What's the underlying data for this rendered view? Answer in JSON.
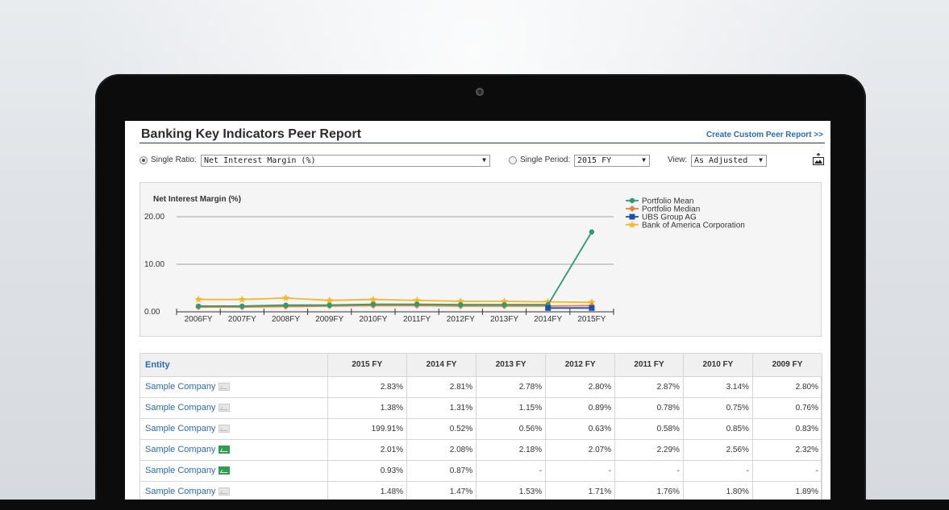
{
  "header": {
    "title": "Banking Key Indicators Peer Report",
    "custom_link": "Create Custom Peer Report >>"
  },
  "controls": {
    "single_ratio_label": "Single Ratio:",
    "ratio_value": "Net Interest Margin (%)",
    "single_period_label": "Single Period:",
    "period_value": "2015 FY",
    "view_label": "View:",
    "view_value": "As Adjusted"
  },
  "chart_data": {
    "type": "line",
    "title": "Net Interest Margin (%)",
    "x": [
      "2006FY",
      "2007FY",
      "2008FY",
      "2009FY",
      "2010FY",
      "2011FY",
      "2012FY",
      "2013FY",
      "2014FY",
      "2015FY"
    ],
    "ylim": [
      0,
      20
    ],
    "yticks": [
      "0.00",
      "10.00",
      "20.00"
    ],
    "legend_position": "top-right",
    "series": [
      {
        "name": "Portfolio Mean",
        "color": "#2e9a72",
        "marker": "circle",
        "values": [
          1.2,
          1.2,
          1.4,
          1.4,
          1.6,
          1.6,
          1.5,
          1.5,
          1.5,
          16.8
        ]
      },
      {
        "name": "Portfolio Median",
        "color": "#e8813a",
        "marker": "diamond",
        "values": [
          1.0,
          1.0,
          1.1,
          1.2,
          1.3,
          1.3,
          1.2,
          1.2,
          1.2,
          1.3
        ]
      },
      {
        "name": "UBS Group AG",
        "color": "#1f4fa8",
        "marker": "square",
        "values": [
          null,
          null,
          null,
          null,
          null,
          null,
          null,
          null,
          0.8,
          0.8
        ]
      },
      {
        "name": "Bank of America Corporation",
        "color": "#f4b82b",
        "marker": "star",
        "values": [
          2.6,
          2.6,
          2.9,
          2.4,
          2.6,
          2.4,
          2.2,
          2.2,
          2.1,
          2.0
        ]
      }
    ]
  },
  "table": {
    "entity_header": "Entity",
    "columns": [
      "2015 FY",
      "2014 FY",
      "2013 FY",
      "2012 FY",
      "2011 FY",
      "2010 FY",
      "2009 FY"
    ],
    "rows": [
      {
        "name": "Sample Company",
        "icon_active": false,
        "values": [
          "2.83%",
          "2.81%",
          "2.78%",
          "2.80%",
          "2.87%",
          "3.14%",
          "2.80%"
        ]
      },
      {
        "name": "Sample Company",
        "icon_active": false,
        "values": [
          "1.38%",
          "1.31%",
          "1.15%",
          "0.89%",
          "0.78%",
          "0.75%",
          "0.76%"
        ]
      },
      {
        "name": "Sample Company",
        "icon_active": false,
        "values": [
          "199.91%",
          "0.52%",
          "0.56%",
          "0.63%",
          "0.58%",
          "0.85%",
          "0.83%"
        ]
      },
      {
        "name": "Sample Company",
        "icon_active": true,
        "values": [
          "2.01%",
          "2.08%",
          "2.18%",
          "2.07%",
          "2.29%",
          "2.56%",
          "2.32%"
        ]
      },
      {
        "name": "Sample Company",
        "icon_active": true,
        "values": [
          "0.93%",
          "0.87%",
          "-",
          "-",
          "-",
          "-",
          "-"
        ]
      },
      {
        "name": "Sample Company",
        "icon_active": false,
        "values": [
          "1.48%",
          "1.47%",
          "1.53%",
          "1.71%",
          "1.76%",
          "1.80%",
          "1.89%"
        ]
      }
    ]
  }
}
